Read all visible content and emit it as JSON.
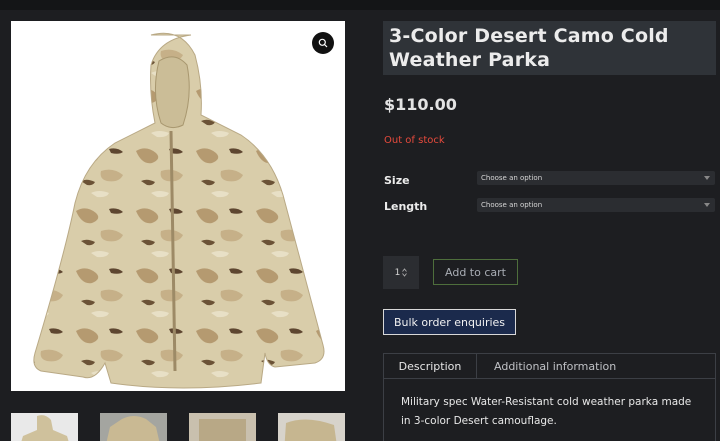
{
  "product": {
    "title": "3-Color Desert Camo Cold Weather Parka",
    "price": "$110.00",
    "stock_status": "Out of stock"
  },
  "variations": [
    {
      "label": "Size",
      "placeholder": "Choose an option"
    },
    {
      "label": "Length",
      "placeholder": "Choose an option"
    }
  ],
  "cart": {
    "quantity": "1",
    "add_to_cart_label": "Add to cart",
    "bulk_label": "Bulk order enquiries"
  },
  "tabs": {
    "description_label": "Description",
    "additional_label": "Additional information",
    "description_text": "Military spec Water-Resistant cold weather parka made in 3-color Desert camouflage."
  },
  "icons": {
    "zoom": "search-icon",
    "qty_spinner": "spinner-icon",
    "select_caret": "chevron-down-icon"
  },
  "colors": {
    "background": "#1d1e21",
    "stock_out": "#e64a3c",
    "bulk_button": "#1b2a4c",
    "cart_border": "#4e6e3c"
  }
}
